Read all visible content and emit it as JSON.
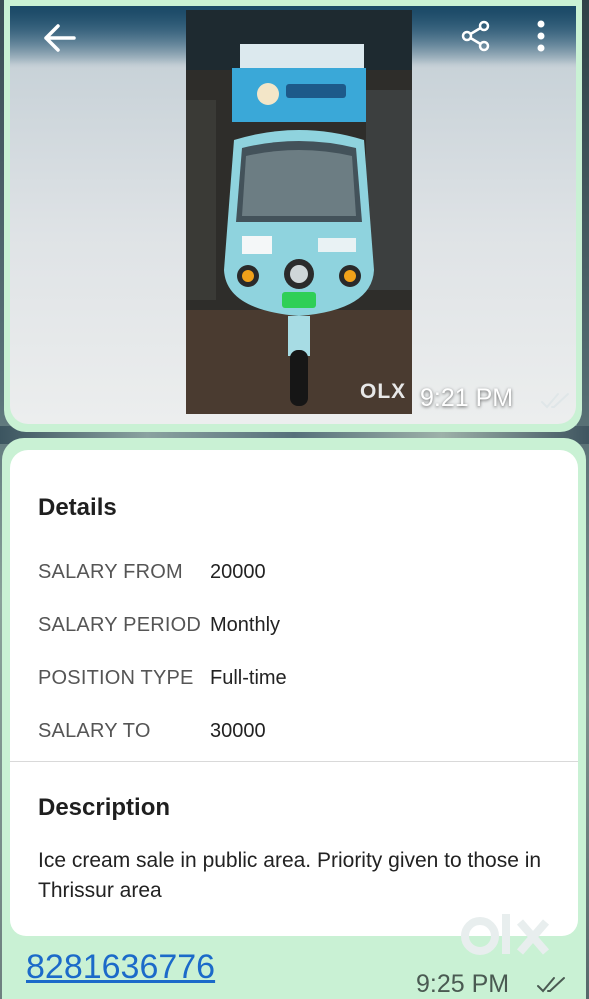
{
  "image_message": {
    "watermark": "OLX",
    "time": "9:21 PM"
  },
  "details": {
    "heading": "Details",
    "rows": [
      {
        "label": "SALARY FROM",
        "value": "20000"
      },
      {
        "label": "SALARY PERIOD",
        "value": "Monthly"
      },
      {
        "label": "POSITION TYPE",
        "value": "Full-time"
      },
      {
        "label": "SALARY TO",
        "value": "30000"
      }
    ]
  },
  "description": {
    "heading": "Description",
    "text": "Ice cream sale in public area. Priority given to those in Thrissur area"
  },
  "text_message": {
    "phone": "8281636776",
    "time": "9:25 PM"
  },
  "icons": [
    "back-arrow-icon",
    "share-icon",
    "more-vert-icon",
    "double-check-icon",
    "olx-logo-icon"
  ],
  "colors": {
    "bubble": "#c9f1d4",
    "link": "#1b6ac9"
  }
}
